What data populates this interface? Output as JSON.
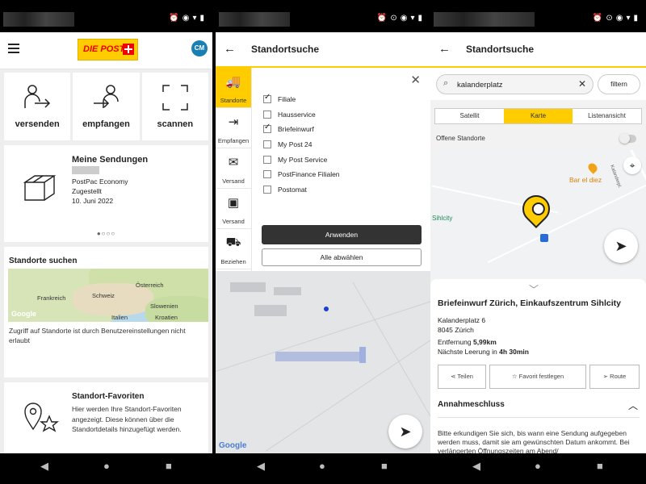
{
  "screen1": {
    "avatar": "CM",
    "logo_text": "DIE POST",
    "actions": [
      {
        "label": "versenden",
        "icon": "person-send-icon"
      },
      {
        "label": "empfangen",
        "icon": "person-receive-icon"
      },
      {
        "label": "scannen",
        "icon": "scan-frame-icon"
      }
    ],
    "sendungen": {
      "title": "Meine Sendungen",
      "type": "PostPac Economy",
      "status": "Zugestellt",
      "date": "10. Juni 2022",
      "pager": "●○○○"
    },
    "standorte": {
      "title": "Standorte suchen",
      "map_labels": [
        "Österreich",
        "Frankreich",
        "Schweiz",
        "Slowenien",
        "Kroatien",
        "Italien"
      ],
      "google": "Google",
      "note": "Zugriff auf Standorte ist durch Benutzereinstellungen nicht erlaubt"
    },
    "favoriten": {
      "title": "Standort-Favoriten",
      "text": "Hier werden Ihre Standort-Favoriten angezeigt. Diese können über die Standortdetails hinzugefügt werden."
    }
  },
  "screen2": {
    "title": "Standortsuche",
    "tabs": [
      {
        "label": "Standorte",
        "icon": "car-pin-icon",
        "active": true
      },
      {
        "label": "Empfangen",
        "icon": "person-receive-icon",
        "active": false
      },
      {
        "label": "Versand",
        "icon": "envelope-icon",
        "active": false
      },
      {
        "label": "Versand",
        "icon": "parcel-icon",
        "active": false
      },
      {
        "label": "Beziehen",
        "icon": "shopping-icon",
        "active": false
      }
    ],
    "filters": [
      {
        "label": "Filiale",
        "checked": true
      },
      {
        "label": "Hausservice",
        "checked": false
      },
      {
        "label": "Briefeinwurf",
        "checked": true
      },
      {
        "label": "My Post 24",
        "checked": false
      },
      {
        "label": "My Post Service",
        "checked": false
      },
      {
        "label": "PostFinance Filialen",
        "checked": false
      },
      {
        "label": "Postomat",
        "checked": false
      }
    ],
    "apply": "Anwenden",
    "deselect": "Alle abwählen",
    "google": "Google"
  },
  "screen3": {
    "title": "Standortsuche",
    "search_value": "kalanderplatz",
    "filter_label": "filtern",
    "views": [
      {
        "label": "Satellit",
        "active": false
      },
      {
        "label": "Karte",
        "active": true
      },
      {
        "label": "Listenansicht",
        "active": false
      }
    ],
    "open_label": "Offene Standorte",
    "map": {
      "poi": "Bar el diez",
      "sihlcity": "Sihlcity",
      "street": "Kalanderpl."
    },
    "detail": {
      "title": "Briefeinwurf Zürich, Einkaufszentrum Sihlcity",
      "address1": "Kalanderplatz 6",
      "address2": "8045 Zürich",
      "distance_label": "Entfernung",
      "distance": "5,99km",
      "next_label": "Nächste Leerung in",
      "next": "4h 30min",
      "actions": [
        "Teilen",
        "Favorit festlegen",
        "Route"
      ],
      "section": "Annahmeschluss",
      "section_text": "Bitte erkundigen Sie sich, bis wann eine Sendung aufgegeben werden muss, damit sie am gewünschten Datum ankommt. Bei verlängerten Öffnungszeiten am Abend/"
    }
  }
}
